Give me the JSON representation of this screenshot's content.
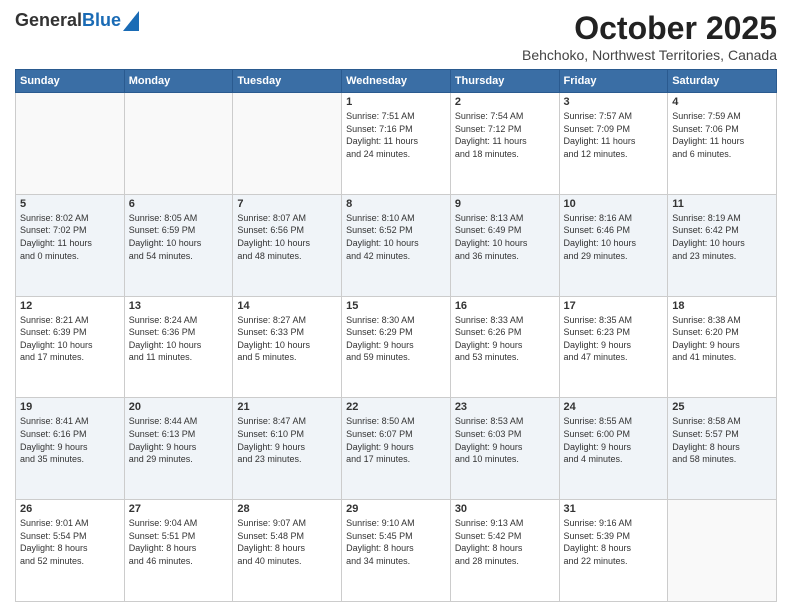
{
  "header": {
    "logo_general": "General",
    "logo_blue": "Blue",
    "main_title": "October 2025",
    "subtitle": "Behchoko, Northwest Territories, Canada"
  },
  "calendar": {
    "days_of_week": [
      "Sunday",
      "Monday",
      "Tuesday",
      "Wednesday",
      "Thursday",
      "Friday",
      "Saturday"
    ],
    "weeks": [
      [
        {
          "day": "",
          "info": ""
        },
        {
          "day": "",
          "info": ""
        },
        {
          "day": "",
          "info": ""
        },
        {
          "day": "1",
          "info": "Sunrise: 7:51 AM\nSunset: 7:16 PM\nDaylight: 11 hours\nand 24 minutes."
        },
        {
          "day": "2",
          "info": "Sunrise: 7:54 AM\nSunset: 7:12 PM\nDaylight: 11 hours\nand 18 minutes."
        },
        {
          "day": "3",
          "info": "Sunrise: 7:57 AM\nSunset: 7:09 PM\nDaylight: 11 hours\nand 12 minutes."
        },
        {
          "day": "4",
          "info": "Sunrise: 7:59 AM\nSunset: 7:06 PM\nDaylight: 11 hours\nand 6 minutes."
        }
      ],
      [
        {
          "day": "5",
          "info": "Sunrise: 8:02 AM\nSunset: 7:02 PM\nDaylight: 11 hours\nand 0 minutes."
        },
        {
          "day": "6",
          "info": "Sunrise: 8:05 AM\nSunset: 6:59 PM\nDaylight: 10 hours\nand 54 minutes."
        },
        {
          "day": "7",
          "info": "Sunrise: 8:07 AM\nSunset: 6:56 PM\nDaylight: 10 hours\nand 48 minutes."
        },
        {
          "day": "8",
          "info": "Sunrise: 8:10 AM\nSunset: 6:52 PM\nDaylight: 10 hours\nand 42 minutes."
        },
        {
          "day": "9",
          "info": "Sunrise: 8:13 AM\nSunset: 6:49 PM\nDaylight: 10 hours\nand 36 minutes."
        },
        {
          "day": "10",
          "info": "Sunrise: 8:16 AM\nSunset: 6:46 PM\nDaylight: 10 hours\nand 29 minutes."
        },
        {
          "day": "11",
          "info": "Sunrise: 8:19 AM\nSunset: 6:42 PM\nDaylight: 10 hours\nand 23 minutes."
        }
      ],
      [
        {
          "day": "12",
          "info": "Sunrise: 8:21 AM\nSunset: 6:39 PM\nDaylight: 10 hours\nand 17 minutes."
        },
        {
          "day": "13",
          "info": "Sunrise: 8:24 AM\nSunset: 6:36 PM\nDaylight: 10 hours\nand 11 minutes."
        },
        {
          "day": "14",
          "info": "Sunrise: 8:27 AM\nSunset: 6:33 PM\nDaylight: 10 hours\nand 5 minutes."
        },
        {
          "day": "15",
          "info": "Sunrise: 8:30 AM\nSunset: 6:29 PM\nDaylight: 9 hours\nand 59 minutes."
        },
        {
          "day": "16",
          "info": "Sunrise: 8:33 AM\nSunset: 6:26 PM\nDaylight: 9 hours\nand 53 minutes."
        },
        {
          "day": "17",
          "info": "Sunrise: 8:35 AM\nSunset: 6:23 PM\nDaylight: 9 hours\nand 47 minutes."
        },
        {
          "day": "18",
          "info": "Sunrise: 8:38 AM\nSunset: 6:20 PM\nDaylight: 9 hours\nand 41 minutes."
        }
      ],
      [
        {
          "day": "19",
          "info": "Sunrise: 8:41 AM\nSunset: 6:16 PM\nDaylight: 9 hours\nand 35 minutes."
        },
        {
          "day": "20",
          "info": "Sunrise: 8:44 AM\nSunset: 6:13 PM\nDaylight: 9 hours\nand 29 minutes."
        },
        {
          "day": "21",
          "info": "Sunrise: 8:47 AM\nSunset: 6:10 PM\nDaylight: 9 hours\nand 23 minutes."
        },
        {
          "day": "22",
          "info": "Sunrise: 8:50 AM\nSunset: 6:07 PM\nDaylight: 9 hours\nand 17 minutes."
        },
        {
          "day": "23",
          "info": "Sunrise: 8:53 AM\nSunset: 6:03 PM\nDaylight: 9 hours\nand 10 minutes."
        },
        {
          "day": "24",
          "info": "Sunrise: 8:55 AM\nSunset: 6:00 PM\nDaylight: 9 hours\nand 4 minutes."
        },
        {
          "day": "25",
          "info": "Sunrise: 8:58 AM\nSunset: 5:57 PM\nDaylight: 8 hours\nand 58 minutes."
        }
      ],
      [
        {
          "day": "26",
          "info": "Sunrise: 9:01 AM\nSunset: 5:54 PM\nDaylight: 8 hours\nand 52 minutes."
        },
        {
          "day": "27",
          "info": "Sunrise: 9:04 AM\nSunset: 5:51 PM\nDaylight: 8 hours\nand 46 minutes."
        },
        {
          "day": "28",
          "info": "Sunrise: 9:07 AM\nSunset: 5:48 PM\nDaylight: 8 hours\nand 40 minutes."
        },
        {
          "day": "29",
          "info": "Sunrise: 9:10 AM\nSunset: 5:45 PM\nDaylight: 8 hours\nand 34 minutes."
        },
        {
          "day": "30",
          "info": "Sunrise: 9:13 AM\nSunset: 5:42 PM\nDaylight: 8 hours\nand 28 minutes."
        },
        {
          "day": "31",
          "info": "Sunrise: 9:16 AM\nSunset: 5:39 PM\nDaylight: 8 hours\nand 22 minutes."
        },
        {
          "day": "",
          "info": ""
        }
      ]
    ]
  }
}
